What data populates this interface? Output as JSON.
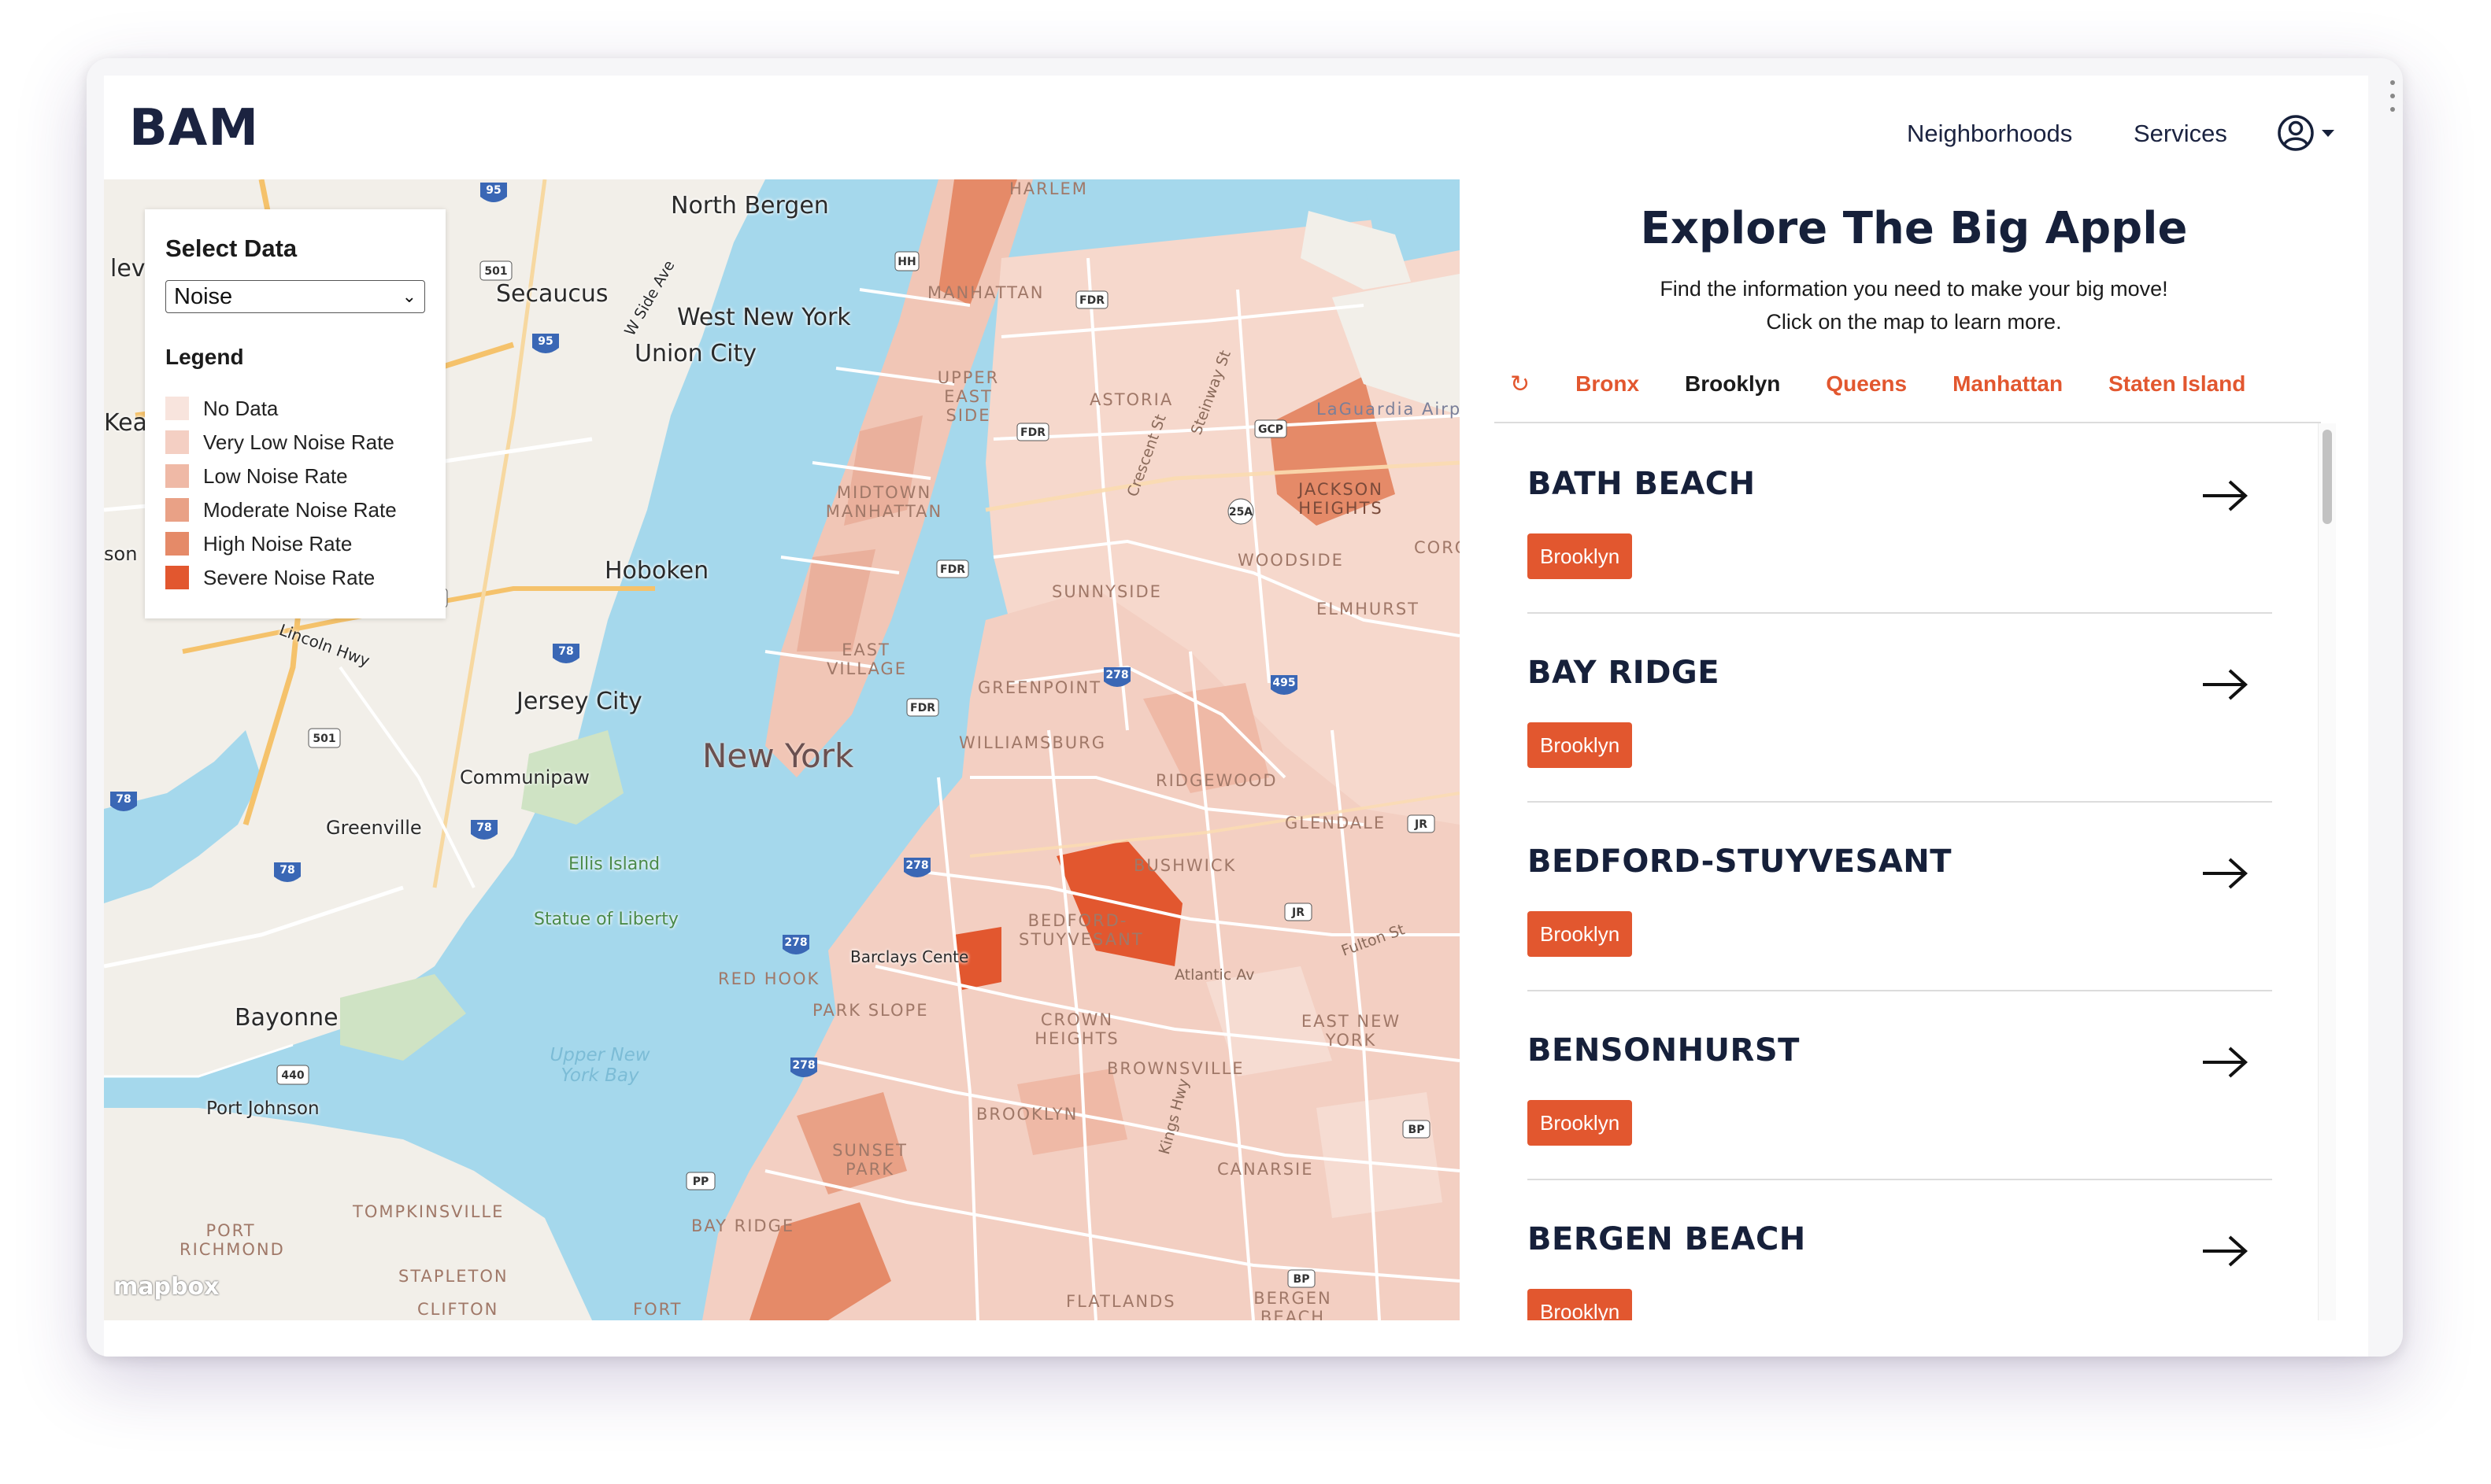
{
  "nav": {
    "logo": "BAM",
    "neighborhoods": "Neighborhoods",
    "services": "Services",
    "user_icon": "user-circle-icon"
  },
  "map": {
    "attribution": "mapbox",
    "labels": {
      "north_bergen": "North Bergen",
      "secaucus": "Secaucus",
      "west_new_york": "West New York",
      "union_city": "Union City",
      "hoboken": "Hoboken",
      "jersey_city": "Jersey City",
      "communipaw": "Communipaw",
      "greenville": "Greenville",
      "ellis_island": "Ellis Island",
      "statue_of_liberty": "Statue of Liberty",
      "bayonne": "Bayonne",
      "port_johnson": "Port Johnson",
      "new_york": "New York",
      "upper_new_york_bay": "Upper New York Bay",
      "manhattan": "MANHATTAN",
      "upper_east_side": "UPPER EAST SIDE",
      "midtown": "MIDTOWN MANHATTAN",
      "east_village": "EAST VILLAGE",
      "astoria": "ASTORIA",
      "jackson_heights": "JACKSON HEIGHTS",
      "woodside": "WOODSIDE",
      "sunnyside": "SUNNYSIDE",
      "elmhurst": "ELMHURST",
      "greenpoint": "GREENPOINT",
      "williamsburg": "WILLIAMSBURG",
      "ridgewood": "RIDGEWOOD",
      "glendale": "GLENDALE",
      "bushwick": "BUSHWICK",
      "bedford_stuyvesant": "BEDFORD-STUYVESANT",
      "barclays": "Barclays Cente",
      "red_hook": "RED HOOK",
      "park_slope": "PARK SLOPE",
      "crown_heights": "CROWN HEIGHTS",
      "brownsville": "BROWNSVILLE",
      "east_new_york": "EAST NEW YORK",
      "brooklyn": "BROOKLYN",
      "sunset_park": "SUNSET PARK",
      "bay_ridge": "BAY RIDGE",
      "canarsie": "CANARSIE",
      "flatlands": "FLATLANDS",
      "bergen_beach": "BERGEN BEACH",
      "tompkinsville": "TOMPKINSVILLE",
      "port_richmond": "PORT RICHMOND",
      "stapleton": "STAPLETON",
      "clifton": "CLIFTON",
      "fort": "FORT",
      "laguardia": "LaGuardia Airpor",
      "corona": "CORO",
      "lincoln_hwy": "Lincoln Hwy",
      "atlantic_av": "Atlantic Av",
      "fulton_st": "Fulton St",
      "w_side_ave": "W Side Ave",
      "crescent_st": "Crescent St",
      "steinway_st": "Steinway St",
      "kings_hwy": "Kings Hwy",
      "harlem": "HARLEM",
      "edge_l1": "levi",
      "edge_l2": "Kea",
      "edge_l3": "son"
    }
  },
  "select_panel": {
    "title": "Select Data",
    "selected": "Noise",
    "legend_title": "Legend",
    "legend": [
      {
        "label": "No Data",
        "color": "#f8e4dd"
      },
      {
        "label": "Very Low Noise Rate",
        "color": "#f4cfc3"
      },
      {
        "label": "Low Noise Rate",
        "color": "#efb9a6"
      },
      {
        "label": "Moderate Noise Rate",
        "color": "#e9a186"
      },
      {
        "label": "High Noise Rate",
        "color": "#e58a68"
      },
      {
        "label": "Severe Noise Rate",
        "color": "#e2572f"
      }
    ]
  },
  "side": {
    "title": "Explore The Big Apple",
    "subtitle_1": "Find the information you need to make your big move!",
    "subtitle_2": "Click on the map to learn more.",
    "tabs": [
      "Bronx",
      "Brooklyn",
      "Queens",
      "Manhattan",
      "Staten Island"
    ],
    "active_tab": "Brooklyn",
    "neighborhoods": [
      {
        "name": "BATH BEACH",
        "borough": "Brooklyn"
      },
      {
        "name": "BAY RIDGE",
        "borough": "Brooklyn"
      },
      {
        "name": "BEDFORD-STUYVESANT",
        "borough": "Brooklyn"
      },
      {
        "name": "BENSONHURST",
        "borough": "Brooklyn"
      },
      {
        "name": "BERGEN BEACH",
        "borough": "Brooklyn"
      }
    ]
  },
  "colors": {
    "accent": "#e2572f",
    "navy": "#16203a",
    "water": "#a5d8ec",
    "land": "#f2efe9"
  }
}
